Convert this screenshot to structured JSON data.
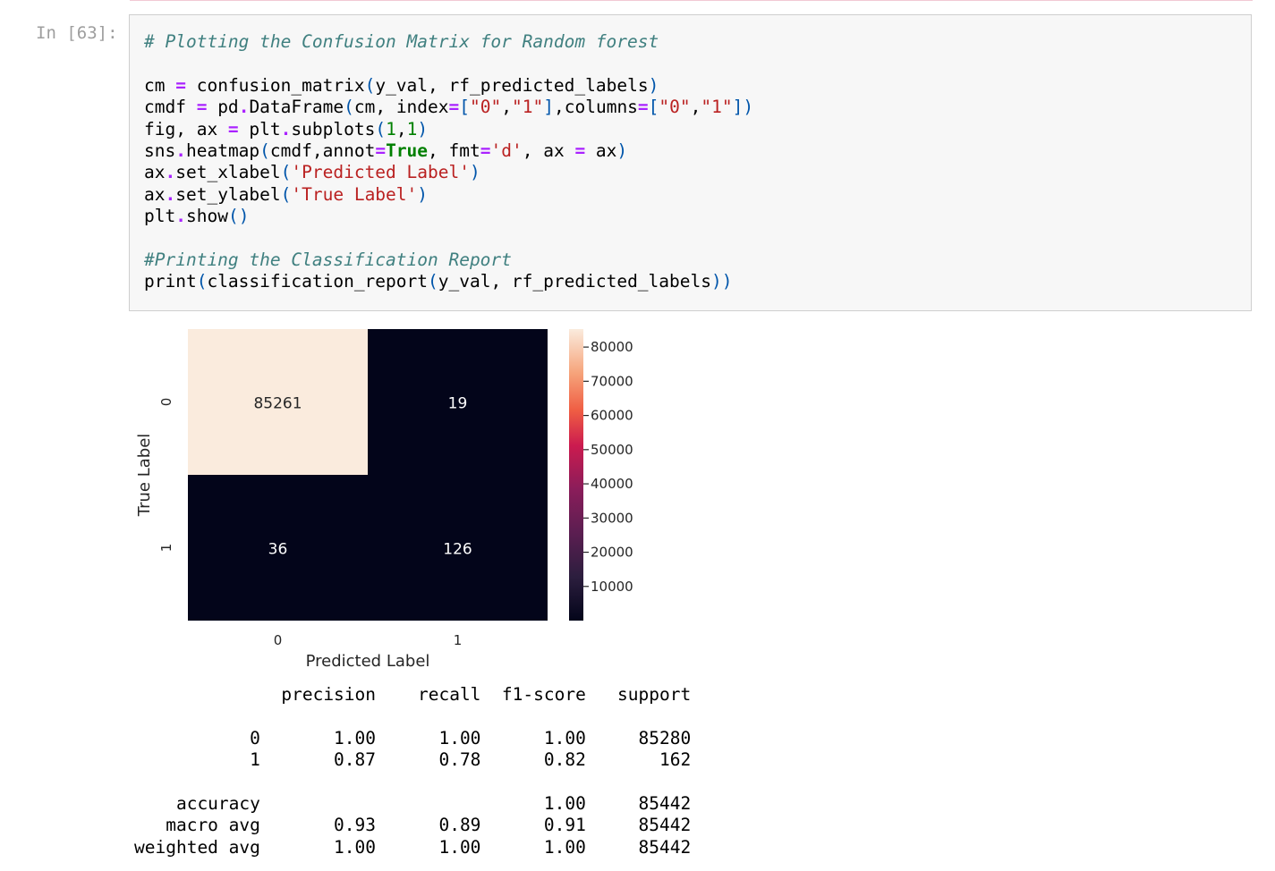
{
  "cell": {
    "prompt": "In [63]:",
    "code_lines": [
      [
        {
          "t": "# Plotting the Confusion Matrix for Random forest",
          "c": "c"
        }
      ],
      [],
      [
        {
          "t": "cm "
        },
        {
          "t": "=",
          "c": "o"
        },
        {
          "t": " confusion_matrix"
        },
        {
          "t": "(",
          "c": "p"
        },
        {
          "t": "y_val, rf_predicted_labels"
        },
        {
          "t": ")",
          "c": "p"
        }
      ],
      [
        {
          "t": "cmdf "
        },
        {
          "t": "=",
          "c": "o"
        },
        {
          "t": " pd"
        },
        {
          "t": ".",
          "c": "o"
        },
        {
          "t": "DataFrame"
        },
        {
          "t": "(",
          "c": "p"
        },
        {
          "t": "cm, index"
        },
        {
          "t": "=",
          "c": "o"
        },
        {
          "t": "[",
          "c": "p"
        },
        {
          "t": "\"0\"",
          "c": "s"
        },
        {
          "t": ","
        },
        {
          "t": "\"1\"",
          "c": "s"
        },
        {
          "t": "]",
          "c": "p"
        },
        {
          "t": ",columns"
        },
        {
          "t": "=",
          "c": "o"
        },
        {
          "t": "[",
          "c": "p"
        },
        {
          "t": "\"0\"",
          "c": "s"
        },
        {
          "t": ","
        },
        {
          "t": "\"1\"",
          "c": "s"
        },
        {
          "t": "])",
          "c": "p"
        }
      ],
      [
        {
          "t": "fig, ax "
        },
        {
          "t": "=",
          "c": "o"
        },
        {
          "t": " plt"
        },
        {
          "t": ".",
          "c": "o"
        },
        {
          "t": "subplots"
        },
        {
          "t": "(",
          "c": "p"
        },
        {
          "t": "1",
          "c": "n"
        },
        {
          "t": ","
        },
        {
          "t": "1",
          "c": "n"
        },
        {
          "t": ")",
          "c": "p"
        }
      ],
      [
        {
          "t": "sns"
        },
        {
          "t": ".",
          "c": "o"
        },
        {
          "t": "heatmap"
        },
        {
          "t": "(",
          "c": "p"
        },
        {
          "t": "cmdf,annot"
        },
        {
          "t": "=",
          "c": "o"
        },
        {
          "t": "True",
          "c": "k"
        },
        {
          "t": ", fmt"
        },
        {
          "t": "=",
          "c": "o"
        },
        {
          "t": "'d'",
          "c": "s"
        },
        {
          "t": ", ax "
        },
        {
          "t": "=",
          "c": "o"
        },
        {
          "t": " ax"
        },
        {
          "t": ")",
          "c": "p"
        }
      ],
      [
        {
          "t": "ax"
        },
        {
          "t": ".",
          "c": "o"
        },
        {
          "t": "set_xlabel"
        },
        {
          "t": "(",
          "c": "p"
        },
        {
          "t": "'Predicted Label'",
          "c": "s"
        },
        {
          "t": ")",
          "c": "p"
        }
      ],
      [
        {
          "t": "ax"
        },
        {
          "t": ".",
          "c": "o"
        },
        {
          "t": "set_ylabel"
        },
        {
          "t": "(",
          "c": "p"
        },
        {
          "t": "'True Label'",
          "c": "s"
        },
        {
          "t": ")",
          "c": "p"
        }
      ],
      [
        {
          "t": "plt"
        },
        {
          "t": ".",
          "c": "o"
        },
        {
          "t": "show"
        },
        {
          "t": "()",
          "c": "p"
        }
      ],
      [],
      [
        {
          "t": "#Printing the Classification Report",
          "c": "c"
        }
      ],
      [
        {
          "t": "print"
        },
        {
          "t": "(",
          "c": "p"
        },
        {
          "t": "classification_report"
        },
        {
          "t": "(",
          "c": "p"
        },
        {
          "t": "y_val, rf_predicted_labels"
        },
        {
          "t": "))",
          "c": "p"
        }
      ]
    ]
  },
  "chart_data": {
    "type": "heatmap",
    "x_categories": [
      "0",
      "1"
    ],
    "y_categories": [
      "0",
      "1"
    ],
    "values": [
      [
        85261,
        19
      ],
      [
        36,
        126
      ]
    ],
    "xlabel": "Predicted Label",
    "ylabel": "True Label",
    "colorbar": {
      "min": 0,
      "max": 85261,
      "ticks": [
        10000,
        20000,
        30000,
        40000,
        50000,
        60000,
        70000,
        80000
      ]
    },
    "colors": {
      "low": "#03051a",
      "high": "#faebdd",
      "text_on_light": "#262626",
      "text_on_dark": "#ffffff"
    }
  },
  "report": {
    "lines": [
      "              precision    recall  f1-score   support",
      "",
      "           0       1.00      1.00      1.00     85280",
      "           1       0.87      0.78      0.82       162",
      "",
      "    accuracy                           1.00     85442",
      "   macro avg       0.93      0.89      0.91     85442",
      "weighted avg       1.00      1.00      1.00     85442"
    ]
  }
}
